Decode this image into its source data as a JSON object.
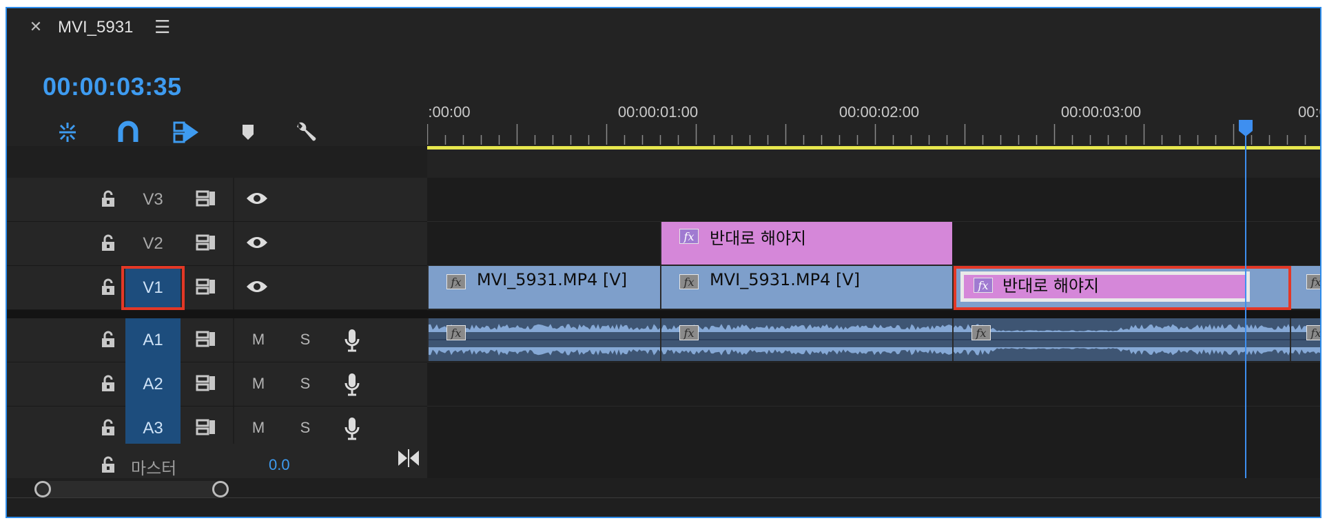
{
  "panel": {
    "close_icon": "close-icon",
    "title": "MVI_5931",
    "menu_icon": "hamburger-menu-icon",
    "timecode": "00:00:03:35"
  },
  "toolbar": [
    {
      "name": "nest-icon",
      "interactable": true
    },
    {
      "name": "snap-magnet-icon",
      "interactable": true
    },
    {
      "name": "linked-selection-icon",
      "interactable": true
    },
    {
      "name": "add-marker-icon",
      "interactable": true
    },
    {
      "name": "wrench-settings-icon",
      "interactable": true
    }
  ],
  "ruler": {
    "labels": [
      ":00:00",
      "00:00:01:00",
      "00:00:02:00",
      "00:00:03:00",
      "00:00:0"
    ]
  },
  "tracks": {
    "video": [
      {
        "label": "V3",
        "targeted": false,
        "highlighted": false
      },
      {
        "label": "V2",
        "targeted": false,
        "highlighted": false
      },
      {
        "label": "V1",
        "targeted": true,
        "highlighted": true
      }
    ],
    "audio": [
      {
        "label": "A1",
        "m": "M",
        "s": "S"
      },
      {
        "label": "A2",
        "m": "M",
        "s": "S"
      },
      {
        "label": "A3",
        "m": "M",
        "s": "S"
      }
    ],
    "master": {
      "label": "마스터",
      "value": "0.0"
    }
  },
  "clips": {
    "v2": [
      {
        "name": "반대로 해야지",
        "color": "#d587d9"
      }
    ],
    "v1": [
      {
        "name": "MVI_5931.MP4 [V]",
        "color": "#7e9fcb"
      },
      {
        "name": "MVI_5931.MP4 [V]",
        "color": "#7e9fcb"
      },
      {
        "name": "반대로 해야지",
        "color": "#d587d9"
      },
      {
        "name": "",
        "color": "#7e9fcb"
      }
    ],
    "fx_label": "fx"
  },
  "colors": {
    "accent": "#3e9bf0",
    "highlight": "#e33826",
    "work_area": "#e6e64e",
    "video_clip": "#7e9fcb",
    "title_clip": "#d587d9",
    "audio_clip": "#3e5573"
  }
}
